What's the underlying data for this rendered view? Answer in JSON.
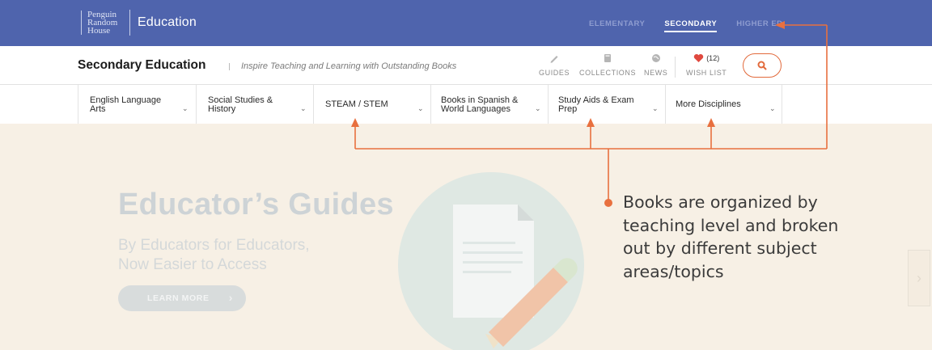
{
  "topbar": {
    "logo_lines": [
      "Penguin",
      "Random",
      "House"
    ],
    "logo_section": "Education",
    "levels": [
      {
        "label": "ELEMENTARY",
        "active": false
      },
      {
        "label": "SECONDARY",
        "active": true
      },
      {
        "label": "HIGHER ED",
        "active": false
      }
    ]
  },
  "subheader": {
    "title": "Secondary Education",
    "tagline": "Inspire Teaching and Learning with Outstanding Books",
    "utilities": {
      "guides": "GUIDES",
      "collections": "COLLECTIONS",
      "news": "NEWS",
      "wishlist_count": "(12)",
      "wishlist": "WISH LIST"
    }
  },
  "disciplines": [
    {
      "line1": "English Language",
      "line2": "Arts"
    },
    {
      "line1": "Social Studies &",
      "line2": "History"
    },
    {
      "line1": "STEAM / STEM",
      "line2": ""
    },
    {
      "line1": "Books in Spanish &",
      "line2": "World Languages"
    },
    {
      "line1": "Study Aids & Exam",
      "line2": "Prep"
    },
    {
      "line1": "More Disciplines",
      "line2": ""
    }
  ],
  "hero": {
    "title": "Educator’s Guides",
    "subtitle_line1": "By Educators for Educators,",
    "subtitle_line2": "Now Easier to Access",
    "button_label": "LEARN MORE"
  },
  "annotation": {
    "lines": [
      "Books are organized by",
      "teaching level and broken",
      "out by different subject",
      "areas/topics"
    ]
  },
  "colors": {
    "topbar": "#4f64ad",
    "accent": "#e26a3c",
    "hero_bg": "#f7f0e5"
  }
}
